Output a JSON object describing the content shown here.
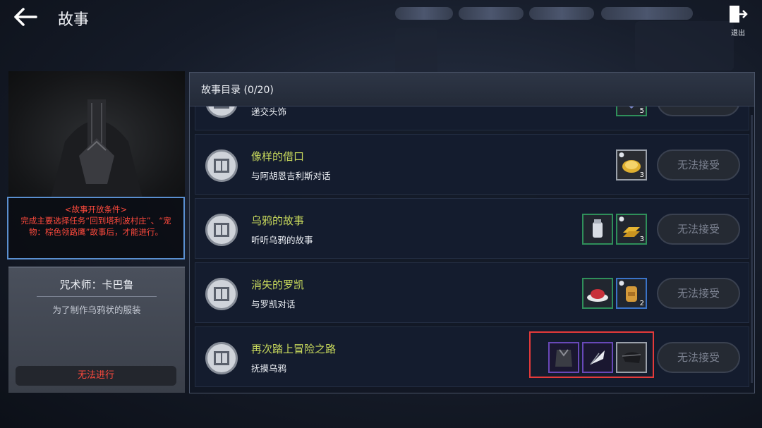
{
  "header": {
    "title": "故事",
    "exit_label": "退出"
  },
  "left_panel": {
    "condition_title": "<故事开放条件>",
    "condition_text": "完成主要选择任务“回到塔利波村庄”、“宠物：棕色领路鹰”故事后，才能进行。",
    "npc_name": "咒术师：卡巴鲁",
    "npc_desc": "为了制作乌鸦状的服装",
    "status_button": "无法进行"
  },
  "quest_list": {
    "header": "故事目录 (0/20)",
    "accept_label": "无法接受",
    "quests": [
      {
        "name": "",
        "subtitle": "递交头饰",
        "rewards": [
          {
            "icon": "crystal-icon",
            "count": "5",
            "frame": "green"
          }
        ]
      },
      {
        "name": "像样的借口",
        "subtitle": "与阿胡恩吉利斯对话",
        "rewards": [
          {
            "icon": "gold-coin-icon",
            "count": "3",
            "frame": "gray"
          }
        ]
      },
      {
        "name": "乌鸦的故事",
        "subtitle": "听听乌鸦的故事",
        "rewards": [
          {
            "icon": "milk-can-icon",
            "count": "",
            "frame": "green"
          },
          {
            "icon": "gold-bars-icon",
            "count": "3",
            "frame": "green"
          }
        ]
      },
      {
        "name": "消失的罗凯",
        "subtitle": "与罗凯对话",
        "rewards": [
          {
            "icon": "meat-platter-icon",
            "count": "",
            "frame": "green"
          },
          {
            "icon": "backpack-icon",
            "count": "2",
            "frame": "blue"
          }
        ]
      },
      {
        "name": "再次踏上冒险之路",
        "subtitle": "抚摸乌鸦",
        "rewards": [
          {
            "icon": "raven-armor-icon",
            "count": "",
            "frame": "purple"
          },
          {
            "icon": "feather-wing-icon",
            "count": "",
            "frame": "purple"
          },
          {
            "icon": "raven-mask-icon",
            "count": "",
            "frame": "gray"
          }
        ]
      }
    ]
  },
  "colors": {
    "quest_title": "#c8d95c",
    "warning_red": "#ff4a3d",
    "highlight_red": "#e53a3a",
    "condition_border": "#5a8fd0"
  }
}
